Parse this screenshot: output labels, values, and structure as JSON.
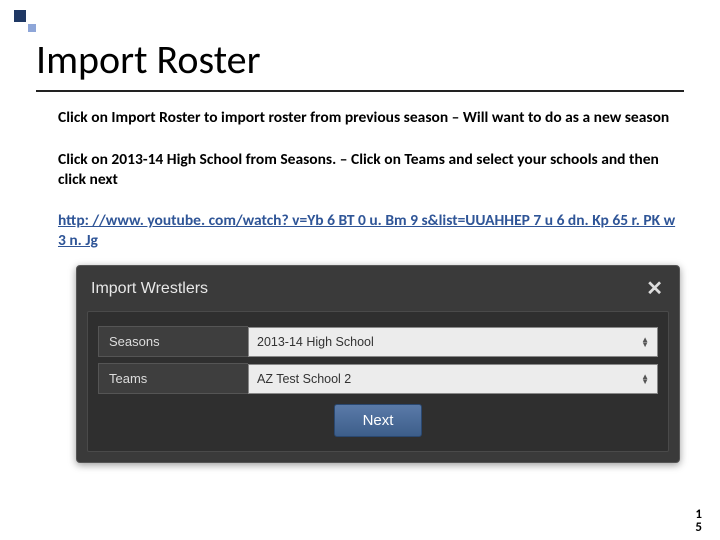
{
  "title": "Import Roster",
  "para1": "Click on Import Roster to import roster from previous season – Will want to do as a new season",
  "para2": "Click on 2013-14 High School from Seasons. – Click on Teams and select your schools and then click next",
  "link_text": "http: //www. youtube. com/watch? v=Yb 6 BT 0 u. Bm 9 s&list=UUAHHEP 7 u 6 dn. Kp 65 r. PK w 3 n. Jg",
  "modal": {
    "title": "Import Wrestlers",
    "rows": [
      {
        "label": "Seasons",
        "value": "2013-14 High School"
      },
      {
        "label": "Teams",
        "value": "AZ Test School 2"
      }
    ],
    "next": "Next"
  },
  "page": {
    "a": "1",
    "b": "5"
  }
}
